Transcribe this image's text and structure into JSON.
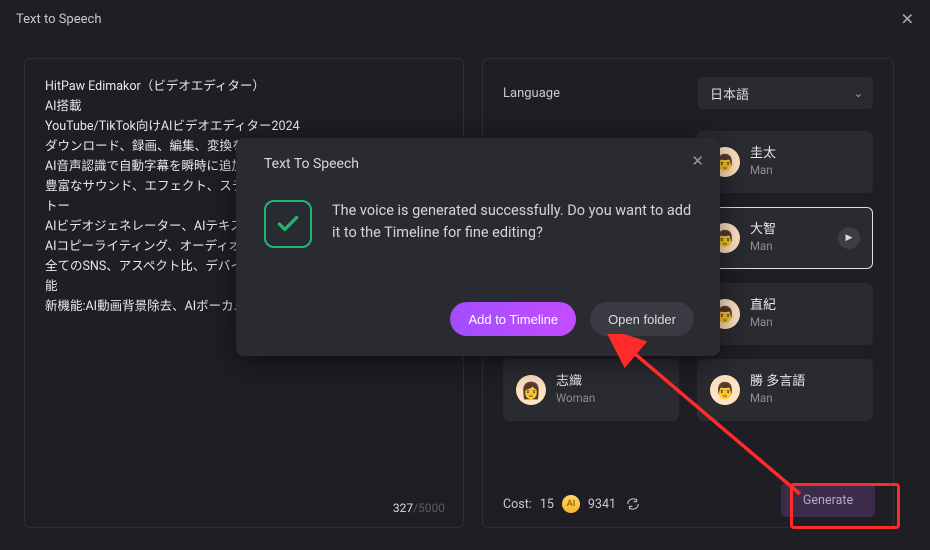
{
  "window": {
    "title": "Text to Speech"
  },
  "editor": {
    "text": "HitPaw Edimakor（ビデオエディター）\nAI搭載\nYouTube/TikTok向けAIビデオエディター2024\nダウンロード、録画、編集、変換をワンクリックで簡単に実行\nAI音声認識で自動字幕を瞬時に追加を実現\n豊富なサウンド、エフェクト、ステーン、テキストアニメーション、ストー\nAIビデオジェネレーター、AIテキス\nAIコピーライティング、オーディオ\n全てのSNS、アスペクト比、デバイ\n能\n新機能:AI動画背景除去、AIボーカル検出",
    "count": "327",
    "max": "/5000"
  },
  "language": {
    "label": "Language",
    "value": "日本語"
  },
  "voices": [
    {
      "name": "圭太",
      "gender": "Man",
      "emoji": "👨"
    },
    {
      "name": "大智",
      "gender": "Man",
      "emoji": "👨",
      "selected": true
    },
    {
      "name": "直紀",
      "gender": "Man",
      "emoji": "👨"
    },
    {
      "name": "志織",
      "gender": "Woman",
      "emoji": "👩"
    },
    {
      "name": "勝 多言語",
      "gender": "Man",
      "emoji": "👨"
    }
  ],
  "cost": {
    "label": "Cost:",
    "value": "15",
    "balance": "9341"
  },
  "generate_label": "Generate",
  "modal": {
    "title": "Text To Speech",
    "message": "The voice is generated successfully. Do you want to add it to the Timeline for fine editing?",
    "primary": "Add to Timeline",
    "secondary": "Open folder"
  }
}
